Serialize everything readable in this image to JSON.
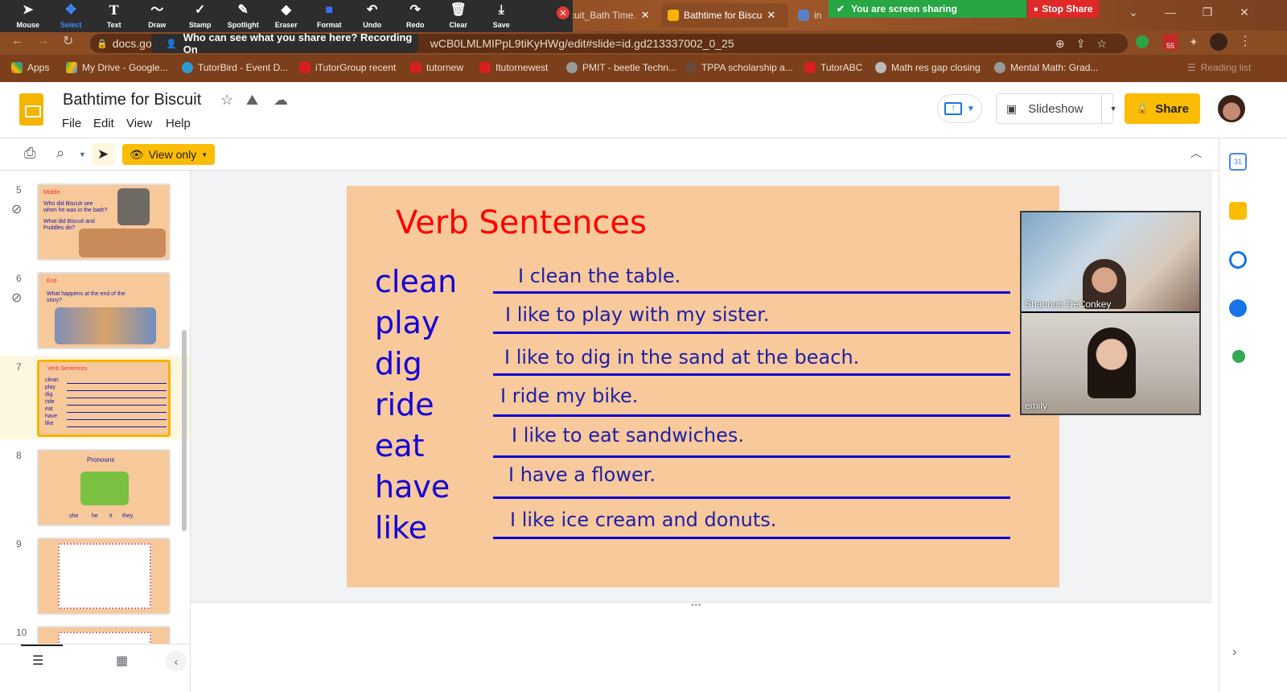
{
  "annotation_toolbar": {
    "tools": [
      {
        "label": "Mouse",
        "icon": "cursor-icon",
        "glyph": "➤"
      },
      {
        "label": "Select",
        "icon": "select-icon",
        "glyph": "✥",
        "selected": true
      },
      {
        "label": "Text",
        "icon": "text-icon",
        "glyph": "T"
      },
      {
        "label": "Draw",
        "icon": "draw-icon",
        "glyph": "〜"
      },
      {
        "label": "Stamp",
        "icon": "stamp-icon",
        "glyph": "✓"
      },
      {
        "label": "Spotlight",
        "icon": "spotlight-icon",
        "glyph": "✎"
      },
      {
        "label": "Eraser",
        "icon": "eraser-icon",
        "glyph": "◆"
      },
      {
        "label": "Format",
        "icon": "format-icon",
        "glyph": "■"
      },
      {
        "label": "Undo",
        "icon": "undo-icon",
        "glyph": "↶"
      },
      {
        "label": "Redo",
        "icon": "redo-icon",
        "glyph": "↷"
      },
      {
        "label": "Clear",
        "icon": "trash-icon",
        "glyph": "🗑"
      },
      {
        "label": "Save",
        "icon": "save-icon",
        "glyph": "⤓"
      }
    ],
    "notice": "Who can see what you share here? Recording On",
    "sharing_text": "You are screen sharing",
    "stop_share": "Stop Share"
  },
  "browser": {
    "tabs": [
      {
        "title": "cuit_Bath Time.",
        "active": false
      },
      {
        "title": "Bathtime for Biscu",
        "active": true
      },
      {
        "title": "in",
        "active": false
      }
    ],
    "url_host": "docs.go",
    "url_rest": "wCB0LMLMIPpL9tiKyHWg/edit#slide=id.gd213337002_0_25",
    "bookmarks": [
      "Apps",
      "My Drive - Google...",
      "TutorBird - Event D...",
      "iTutorGroup recent",
      "tutornew",
      "Itutornewest",
      "PMIT - beetle Techn...",
      "TPPA scholarship a...",
      "TutorABC",
      "Math res gap closing",
      "Mental Math: Grad...",
      "Reading list"
    ],
    "badge": "55"
  },
  "doc": {
    "title": "Bathtime for Biscuit",
    "menu": [
      "File",
      "Edit",
      "View",
      "Help"
    ],
    "slideshow_label": "Slideshow",
    "share_label": "Share",
    "view_only_label": "View only"
  },
  "filmstrip": {
    "slides": [
      {
        "number": "5",
        "heading": "Middle",
        "lines": [
          "Who did Biscuit see",
          "when he was in the bath?",
          "What did Biscuit and",
          "Puddles do?"
        ]
      },
      {
        "number": "6",
        "heading": "End",
        "lines": [
          "What happens at the end of the",
          "story?"
        ]
      },
      {
        "number": "7",
        "heading": "Verb Sentences",
        "lines": [
          "clean",
          "play",
          "dig",
          "ride",
          "eat",
          "have",
          "like"
        ],
        "current": true
      },
      {
        "number": "8",
        "heading": "Pronouns",
        "lines": [
          "she",
          "he",
          "it",
          "they"
        ]
      },
      {
        "number": "9",
        "heading": "",
        "lines": []
      },
      {
        "number": "10",
        "heading": "",
        "lines": []
      }
    ]
  },
  "slide": {
    "title": "Verb Sentences",
    "verbs": [
      "clean",
      "play",
      "dig",
      "ride",
      "eat",
      "have",
      "like"
    ],
    "sentences": [
      "I clean the table.",
      "I like to play with my sister.",
      "I like to dig in the sand at the beach.",
      "I ride my bike.",
      "I like to eat sandwiches.",
      "I have a flower.",
      "I like ice cream and donuts."
    ],
    "colors": {
      "title": "#ff0000",
      "verbs": "#1400d6",
      "background": "#f7c99b",
      "lines": "#0a00d4"
    }
  },
  "video": {
    "participants": [
      "Shannon DeConkey",
      "emily"
    ]
  }
}
